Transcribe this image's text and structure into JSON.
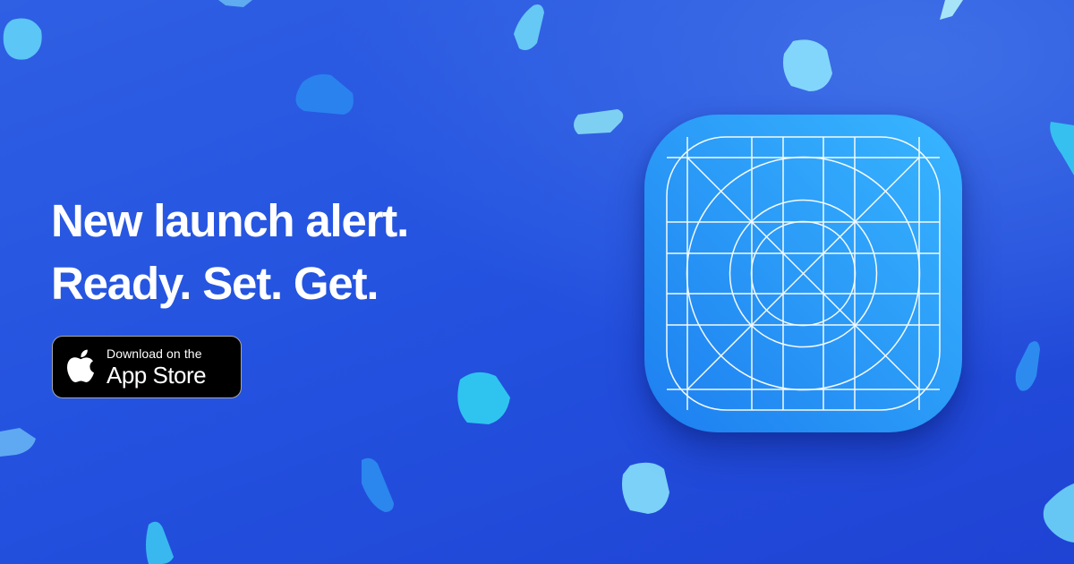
{
  "headline": {
    "line1": "New launch alert.",
    "line2": "Ready. Set. Get."
  },
  "store_badge": {
    "small_text": "Download on the",
    "large_text": "App Store",
    "icon": "apple-logo-icon"
  },
  "app_icon": {
    "icon": "app-icon-grid-template"
  },
  "colors": {
    "background": "#2453e0",
    "icon_light": "#36b3ff",
    "icon_dark": "#1f86f2",
    "badge": "#000000",
    "text": "#ffffff"
  }
}
